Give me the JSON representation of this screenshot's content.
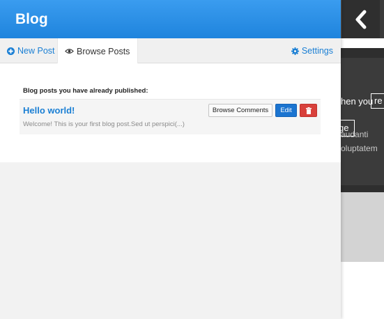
{
  "header": {
    "title": "Blog"
  },
  "tabs": {
    "new_post": "New Post",
    "browse_posts": "Browse Posts",
    "settings": "Settings"
  },
  "main": {
    "section_label": "Blog posts you have already published:",
    "posts": [
      {
        "title": "Hello world!",
        "excerpt": "Welcome! This is your first blog post.Sed ut perspici(...)",
        "browse_comments_label": "Browse Comments",
        "edit_label": "Edit"
      }
    ]
  },
  "background": {
    "text1": "hen you",
    "input_value": "re",
    "button_label": "ge",
    "text2": "audanti",
    "text3": "oluptatem"
  },
  "colors": {
    "header": "#1f84dd",
    "link": "#1a7fd4",
    "edit": "#1b74d0",
    "delete": "#d8403b"
  },
  "icons": {
    "new_post": "plus-circle-icon",
    "browse_posts": "eye-icon",
    "settings": "gear-icon",
    "delete": "trash-icon",
    "collapse": "chevron-left-icon"
  }
}
